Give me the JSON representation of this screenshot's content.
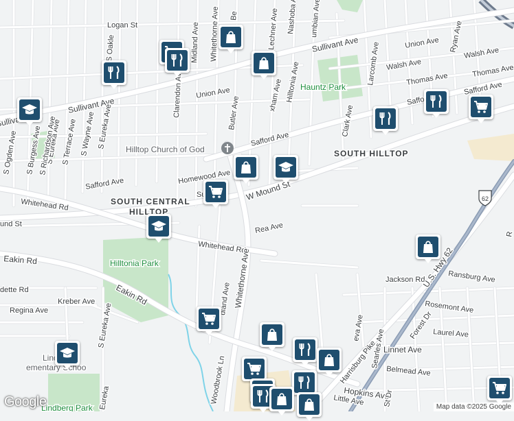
{
  "map": {
    "logo": "Google",
    "attribution": "Map data ©2025 Google",
    "colors": {
      "background": "#f1f3f4",
      "park": "#c8e6c9",
      "water": "#7fd3e8",
      "marker": "#1f4e6e",
      "highway": "#8a9bb3",
      "industrial": "#f4ead0"
    }
  },
  "areas": {
    "south_hilltop": "SOUTH HILLTOP",
    "south_central": "SOUTH CENTRAL",
    "hilltop": "HILLTOP"
  },
  "parks": {
    "hauntz": "Hauntz Park",
    "hilltonia": "Hilltonia Park",
    "lindberg": "Lindberg Park"
  },
  "pois": {
    "church": "Hilltop Church of God",
    "school_lindbergh_1": "Lindbe",
    "school_lindbergh_2": "ementary Schoo"
  },
  "highway_shield": "62",
  "streets": {
    "logan": "Logan St",
    "sullivant_1": "Sullivant Ave",
    "sullivant_2": "Sullivant Ave",
    "sullivant_3": "Sullivant Ave",
    "union_1": "Union Ave",
    "union_2": "Union Ave",
    "walsh_1": "Walsh Ave",
    "walsh_2": "Walsh Ave",
    "thomas_1": "Thomas Ave",
    "thomas_2": "Thomas Ave",
    "safford_1": "Safford Ave",
    "safford_2": "Safford Ave",
    "safford_3": "Safford Ave",
    "safford_4": "Safford Ave",
    "homewood": "Homewood Ave",
    "w_mound": "W Mound St",
    "mound_st": "und St",
    "whitehead_1": "Whitehead Rd",
    "whitehead_2": "Whitehead Rd",
    "rea": "Rea Ave",
    "eakin_1": "Eakin Rd",
    "eakin_2": "Eakin Rd",
    "kreber": "Kreber Ave",
    "regina": "Regina Ave",
    "dette": "dette Rd",
    "ravine": "rave Ave",
    "jackson": "Jackson Rd",
    "ransburg": "Ransburg Ave",
    "rosemont": "Rosemont Ave",
    "laurel": "Laurel Ave",
    "linnet": "Linnet Ave",
    "belmead": "Belmead Ave",
    "hopkins": "Hopkins Ave",
    "little": "Little Ave",
    "us62": "U.S. Hwy 62",
    "harrisburg": "Harrisburg Pike",
    "whitethorne_s": "Whitethorne Ave",
    "whitethorne_n": "Whitethorne Ave",
    "midland_n": "Midland Ave",
    "midland_s": "dland Ave",
    "clarendon": "Clarendon Ave",
    "butler": "Butler Ave",
    "belvidere": "Be",
    "lechner": "Lechner Ave",
    "nashoba": "Nashoba Ave",
    "columbian": "umbian Ave",
    "hilltonia": "Hilltonia Ave",
    "wrexham": "xham Ave",
    "clark": "Clark Ave",
    "larcomb": "Larcomb Ave",
    "ryan": "Ryan Ave",
    "oakley": "S Oakle",
    "s_terrace": "S Terrace Ave",
    "s_eureka_n": "S Eureka Ave",
    "s_wayne": "S Wayne Ave",
    "s_richardson": "S Richardson Ave",
    "s_burgess": "S Burgess Ave",
    "s_ogden": "S Ogden Ave",
    "s_eureka_s": "S Eureka Ave",
    "eureka_s2": "Eureka",
    "woodbrook": "Woodbrook Ln",
    "sunset": "Su",
    "seeds": "Searles Ave",
    "forest": "Forest Dr",
    "st_dr": "St Dr",
    "geneva": "eva Ave",
    "bruce": "R"
  },
  "markers": [
    {
      "type": "shopping",
      "icon": "shopping-bag-icon"
    },
    {
      "type": "grocery",
      "icon": "shopping-cart-icon"
    },
    {
      "type": "restaurant",
      "icon": "fork-knife-icon"
    },
    {
      "type": "restaurant",
      "icon": "fork-knife-icon"
    },
    {
      "type": "shopping",
      "icon": "shopping-bag-icon"
    },
    {
      "type": "school",
      "icon": "graduation-cap-icon"
    },
    {
      "type": "restaurant",
      "icon": "fork-knife-icon"
    },
    {
      "type": "restaurant",
      "icon": "fork-knife-icon"
    },
    {
      "type": "grocery",
      "icon": "shopping-cart-icon"
    },
    {
      "type": "shopping",
      "icon": "shopping-bag-icon"
    },
    {
      "type": "school",
      "icon": "graduation-cap-icon"
    },
    {
      "type": "grocery",
      "icon": "shopping-cart-icon"
    },
    {
      "type": "school",
      "icon": "graduation-cap-icon"
    },
    {
      "type": "shopping",
      "icon": "shopping-bag-icon"
    },
    {
      "type": "grocery",
      "icon": "shopping-cart-icon"
    },
    {
      "type": "shopping",
      "icon": "shopping-bag-icon"
    },
    {
      "type": "school",
      "icon": "graduation-cap-icon"
    },
    {
      "type": "restaurant",
      "icon": "fork-knife-icon"
    },
    {
      "type": "shopping",
      "icon": "shopping-bag-icon"
    },
    {
      "type": "grocery",
      "icon": "shopping-cart-icon"
    },
    {
      "type": "restaurant",
      "icon": "fork-knife-icon"
    },
    {
      "type": "grocery",
      "icon": "shopping-cart-icon"
    },
    {
      "type": "restaurant",
      "icon": "fork-knife-icon"
    },
    {
      "type": "shopping",
      "icon": "shopping-bag-icon"
    },
    {
      "type": "shopping",
      "icon": "shopping-bag-icon"
    },
    {
      "type": "grocery",
      "icon": "shopping-cart-icon"
    }
  ]
}
